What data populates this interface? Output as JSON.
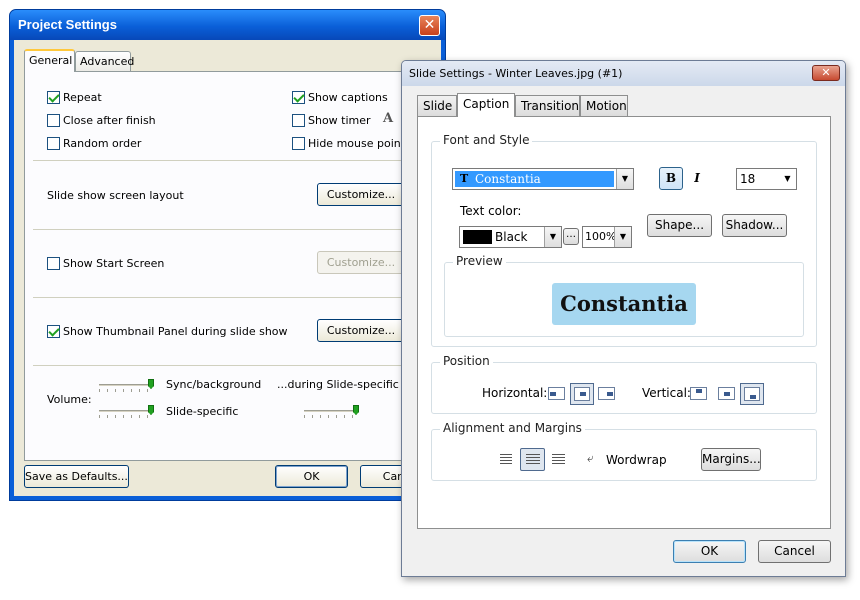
{
  "project_window": {
    "title": "Project Settings",
    "close_glyph": "✕",
    "tabs": [
      {
        "label": "General",
        "active": true
      },
      {
        "label": "Advanced",
        "active": false
      }
    ],
    "checkboxes": {
      "repeat": {
        "label": "Repeat",
        "checked": true
      },
      "close_after_finish": {
        "label": "Close after finish",
        "checked": false
      },
      "random_order": {
        "label": "Random order",
        "checked": false
      },
      "show_captions": {
        "label": "Show captions",
        "checked": true
      },
      "show_timer": {
        "label": "Show timer",
        "checked": false
      },
      "hide_mouse_pointer": {
        "label": "Hide mouse pointer",
        "checked": false
      },
      "show_start_screen": {
        "label": "Show Start Screen",
        "checked": false
      },
      "show_thumbnail_panel": {
        "label": "Show Thumbnail Panel during slide show",
        "checked": true
      }
    },
    "font_icon_glyph": "A",
    "slide_show_layout_label": "Slide show screen layout",
    "customize_label": "Customize...",
    "volume": {
      "label": "Volume:",
      "sync_background_label": "Sync/background",
      "slide_specific_label": "Slide-specific",
      "during_slide_specific_label": "...during Slide-specific"
    },
    "save_defaults_label": "Save as Defaults...",
    "ok_label": "OK",
    "cancel_label": "Canc"
  },
  "slide_window": {
    "title": "Slide Settings - Winter Leaves.jpg (#1)",
    "close_glyph": "✕",
    "tabs": [
      {
        "label": "Slide",
        "active": false
      },
      {
        "label": "Caption",
        "active": true
      },
      {
        "label": "Transition",
        "active": false
      },
      {
        "label": "Motion",
        "active": false
      }
    ],
    "font_style": {
      "group_title": "Font and Style",
      "font_name": "Constantia",
      "font_icon_glyph": "T",
      "bold_glyph": "B",
      "italic_glyph": "I",
      "bold_active": true,
      "size": "18",
      "text_color_label": "Text color:",
      "color_name": "Black",
      "color_value": "#000000",
      "opacity": "100%",
      "shape_label": "Shape...",
      "shadow_label": "Shadow..."
    },
    "preview": {
      "group_title": "Preview",
      "text": "Constantia",
      "background": "#a6d7f0"
    },
    "position": {
      "group_title": "Position",
      "horizontal_label": "Horizontal:",
      "vertical_label": "Vertical:",
      "horizontal_selected": "center",
      "vertical_selected": "bottom"
    },
    "alignment": {
      "group_title": "Alignment and Margins",
      "alignment_selected": "center",
      "wordwrap_label": "Wordwrap",
      "margins_label": "Margins..."
    },
    "ok_label": "OK",
    "cancel_label": "Cancel"
  }
}
